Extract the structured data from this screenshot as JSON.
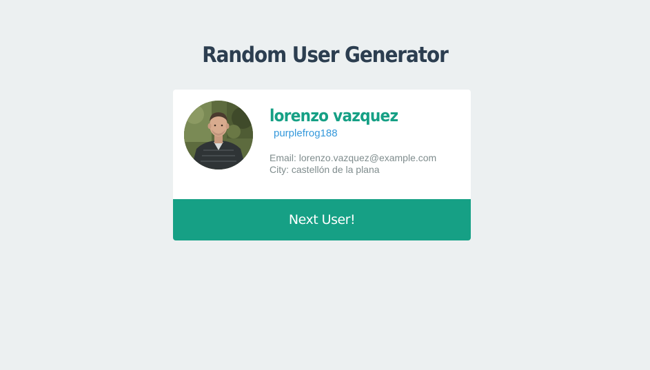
{
  "app": {
    "title": "Random User Generator"
  },
  "user": {
    "name": "lorenzo vazquez",
    "username": "purplefrog188",
    "email_line": "Email: lorenzo.vazquez@example.com",
    "city_line": "City: castellón de la plana",
    "avatar_icon": "user-photo"
  },
  "actions": {
    "next_label": "Next User!"
  },
  "colors": {
    "background": "#ecf0f1",
    "title": "#2c3e50",
    "accent": "#16a085",
    "link": "#3498db",
    "muted": "#7f8c8d"
  }
}
